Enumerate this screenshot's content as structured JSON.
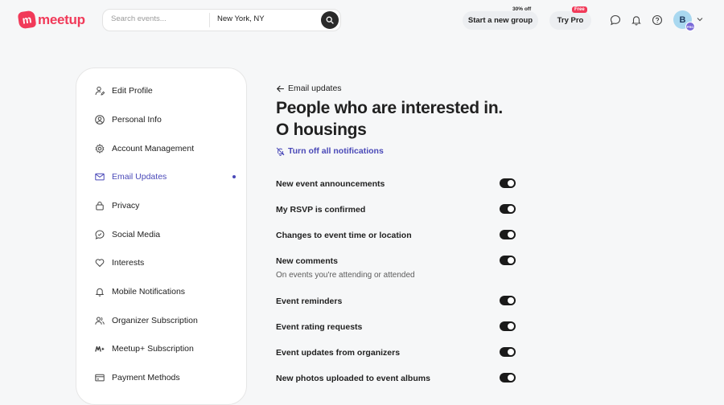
{
  "header": {
    "logo_text": "meetup",
    "logo_mark": "m",
    "search_placeholder": "Search events...",
    "location_value": "New York, NY",
    "new_group_label": "Start a new group",
    "promo_text": "30% off",
    "try_pro_label": "Try Pro",
    "free_badge": "Free",
    "avatar_initial": "B",
    "avatar_badge": "PRO"
  },
  "sidebar": {
    "items": [
      {
        "label": "Edit Profile",
        "icon": "user-edit-icon",
        "active": false
      },
      {
        "label": "Personal Info",
        "icon": "person-circle-icon",
        "active": false
      },
      {
        "label": "Account Management",
        "icon": "gear-icon",
        "active": false
      },
      {
        "label": "Email Updates",
        "icon": "mail-icon",
        "active": true
      },
      {
        "label": "Privacy",
        "icon": "lock-icon",
        "active": false
      },
      {
        "label": "Social Media",
        "icon": "chat-bubble-icon",
        "active": false
      },
      {
        "label": "Interests",
        "icon": "heart-icon",
        "active": false
      },
      {
        "label": "Mobile Notifications",
        "icon": "bell-icon",
        "active": false
      },
      {
        "label": "Organizer Subscription",
        "icon": "people-icon",
        "active": false
      },
      {
        "label": "Meetup+ Subscription",
        "icon": "meetup-plus-icon",
        "active": false
      },
      {
        "label": "Payment Methods",
        "icon": "credit-card-icon",
        "active": false
      }
    ]
  },
  "main": {
    "back_label": "Email updates",
    "title": "People who are interested in. O housings",
    "turn_off_label": "Turn off all notifications",
    "preferences": [
      {
        "label": "New event announcements",
        "sub": "",
        "enabled": true
      },
      {
        "label": "My RSVP is confirmed",
        "sub": "",
        "enabled": true
      },
      {
        "label": "Changes to event time or location",
        "sub": "",
        "enabled": true
      },
      {
        "label": "New comments",
        "sub": "On events you're attending or attended",
        "enabled": true
      },
      {
        "label": "Event reminders",
        "sub": "",
        "enabled": true
      },
      {
        "label": "Event rating requests",
        "sub": "",
        "enabled": true
      },
      {
        "label": "Event updates from organizers",
        "sub": "",
        "enabled": true
      },
      {
        "label": "New photos uploaded to event albums",
        "sub": "",
        "enabled": true
      }
    ]
  },
  "colors": {
    "brand": "#f13a59",
    "accent": "#4a49b8",
    "toggle_on": "#1a1a1a"
  }
}
